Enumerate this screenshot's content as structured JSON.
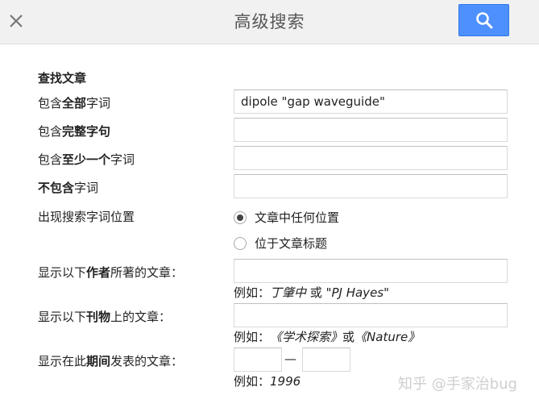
{
  "header": {
    "title": "高级搜索",
    "close_icon": "close-icon",
    "search_icon": "search-icon",
    "search_button_color": "#4d90fe"
  },
  "form": {
    "section_title": "查找文章",
    "all_words": {
      "label_pre": "包含",
      "label_bold": "全部",
      "label_post": "字词",
      "value": "dipole \"gap waveguide\""
    },
    "exact_phrase": {
      "label_pre": "包含",
      "label_bold": "完整字句",
      "label_post": "",
      "value": ""
    },
    "at_least_one": {
      "label_pre": "包含",
      "label_bold": "至少一个",
      "label_post": "字词",
      "value": ""
    },
    "without_words": {
      "label_pre": "",
      "label_bold": "不包含",
      "label_post": "字词",
      "value": ""
    },
    "occurrence": {
      "label": "出现搜索字词位置",
      "options": [
        {
          "label": "文章中任何位置",
          "checked": true
        },
        {
          "label": "位于文章标题",
          "checked": false
        }
      ]
    },
    "author": {
      "label_pre": "显示以下",
      "label_bold": "作者",
      "label_post": "所著的文章：",
      "value": "",
      "example_prefix": "例如：",
      "example_italic": "丁肇中",
      "example_mid": " 或 ",
      "example_italic2": "\"PJ Hayes\""
    },
    "publication": {
      "label_pre": "显示以下",
      "label_bold": "刊物",
      "label_post": "上的文章：",
      "value": "",
      "example_prefix": "例如：",
      "example_italic": "《学术探索》",
      "example_mid": "或",
      "example_italic2": "《Nature》"
    },
    "date_range": {
      "label_pre": "显示在此",
      "label_bold": "期间",
      "label_post": "发表的文章：",
      "from": "",
      "to": "",
      "dash": "—",
      "example_prefix": "例如：",
      "example_italic": "1996"
    }
  },
  "watermark": "知乎 @手家治bug"
}
